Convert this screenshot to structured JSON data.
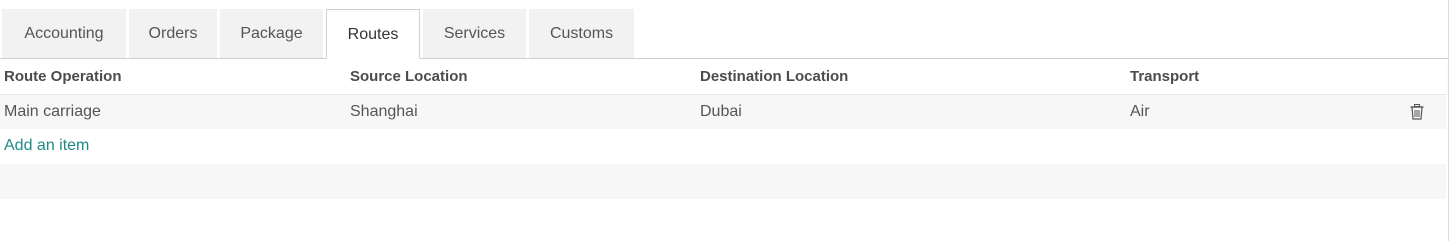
{
  "tabs": [
    {
      "label": "Accounting",
      "active": false
    },
    {
      "label": "Orders",
      "active": false
    },
    {
      "label": "Package",
      "active": false
    },
    {
      "label": "Routes",
      "active": true
    },
    {
      "label": "Services",
      "active": false
    },
    {
      "label": "Customs",
      "active": false
    }
  ],
  "table": {
    "columns": [
      "Route Operation",
      "Source Location",
      "Destination Location",
      "Transport"
    ],
    "rows": [
      {
        "route_operation": "Main carriage",
        "source_location": "Shanghai",
        "destination_location": "Dubai",
        "transport": "Air",
        "action_icon": "trash-icon"
      }
    ],
    "add_item_label": "Add an item"
  },
  "colors": {
    "link": "#1f8c87",
    "row_background": "#f7f7f7",
    "tab_background": "#f2f2f2"
  }
}
